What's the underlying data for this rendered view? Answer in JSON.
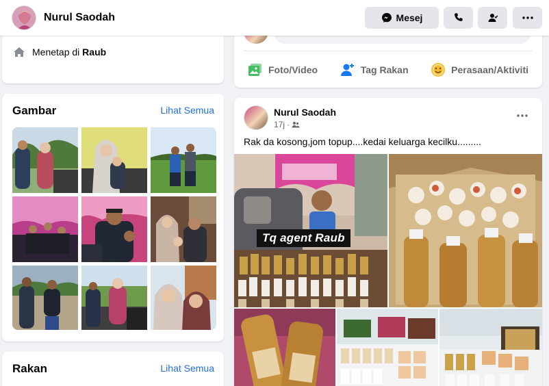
{
  "header": {
    "profile_name": "Nurul Saodah",
    "message_label": "Mesej",
    "icons": [
      "messenger-icon",
      "phone-icon",
      "friend-icon",
      "more-icon"
    ]
  },
  "intro": {
    "lives_prefix": "Menetap di",
    "lives_place": "Raub"
  },
  "photos": {
    "title": "Gambar",
    "see_all": "Lihat Semua",
    "count": 9
  },
  "friends": {
    "title": "Rakan",
    "see_all": "Lihat Semua"
  },
  "composer": {
    "actions": [
      {
        "label": "Foto/Video",
        "icon": "photo-video-icon",
        "color": "#45bd62"
      },
      {
        "label": "Tag Rakan",
        "icon": "tag-friend-icon",
        "color": "#1877f2"
      },
      {
        "label": "Perasaan/Aktiviti",
        "icon": "feeling-icon",
        "color": "#f7b928"
      }
    ]
  },
  "post": {
    "author": "Nurul Saodah",
    "time": "17j",
    "privacy_icon": "friends-icon",
    "text": "Rak da kosong,jom topup....kedai keluarga kecilku.........",
    "overlay_text": "Tq agent Raub"
  },
  "colors": {
    "link": "#216fdb",
    "muted": "#65676b",
    "button_bg": "#e4e6eb",
    "page_bg": "#f0f2f5"
  }
}
